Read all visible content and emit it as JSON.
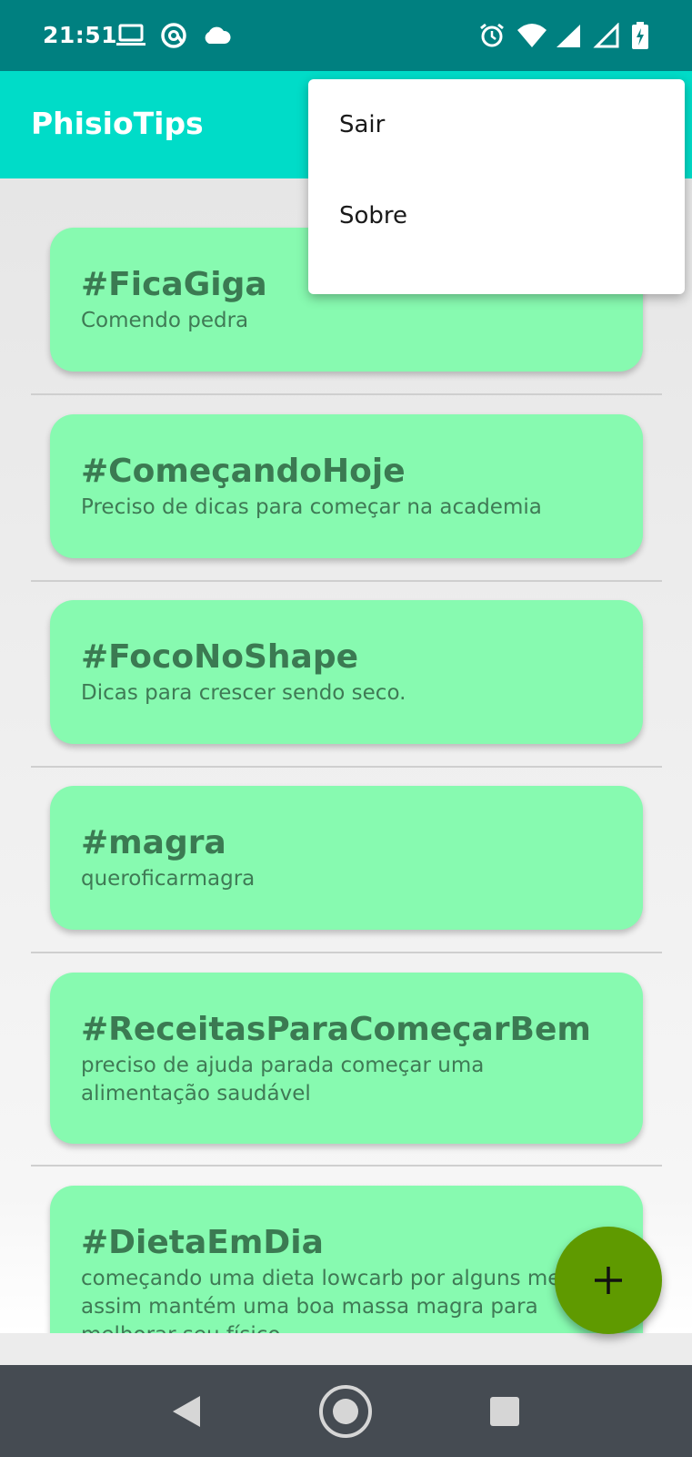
{
  "status_bar": {
    "time": "21:51",
    "left_icons": [
      "laptop-icon",
      "at-sign-icon",
      "cloud-icon"
    ],
    "right_icons": [
      "alarm-icon",
      "wifi-icon",
      "signal-icon",
      "signal-outline-icon",
      "battery-charging-icon"
    ]
  },
  "app_bar": {
    "title": "PhisioTips"
  },
  "menu": {
    "items": [
      {
        "label": "Sair"
      },
      {
        "label": "Sobre"
      }
    ]
  },
  "posts": [
    {
      "title": "#FicaGiga",
      "description": "Comendo pedra"
    },
    {
      "title": "#ComeçandoHoje",
      "description": "Preciso de dicas para começar na academia"
    },
    {
      "title": "#FocoNoShape",
      "description": "Dicas para crescer sendo seco."
    },
    {
      "title": "#magra",
      "description": "queroficarmagra"
    },
    {
      "title": "#ReceitasParaComeçarBem",
      "description": "preciso de ajuda parada começar uma alimentação saudável"
    },
    {
      "title": "#DietaEmDia",
      "description": "começando uma dieta lowcarb por alguns meses assim mantém uma boa massa magra para melhorar seu físico"
    }
  ],
  "fab": {
    "icon": "plus-icon",
    "color": "#5f9a00"
  },
  "nav_bar": {
    "buttons": [
      "back-icon",
      "home-icon",
      "recents-icon"
    ]
  },
  "colors": {
    "status_bar": "#008080",
    "app_bar": "#00dcc8",
    "card": "#87fab0",
    "card_text": "#3b7a52",
    "nav_bar": "#454b52"
  }
}
